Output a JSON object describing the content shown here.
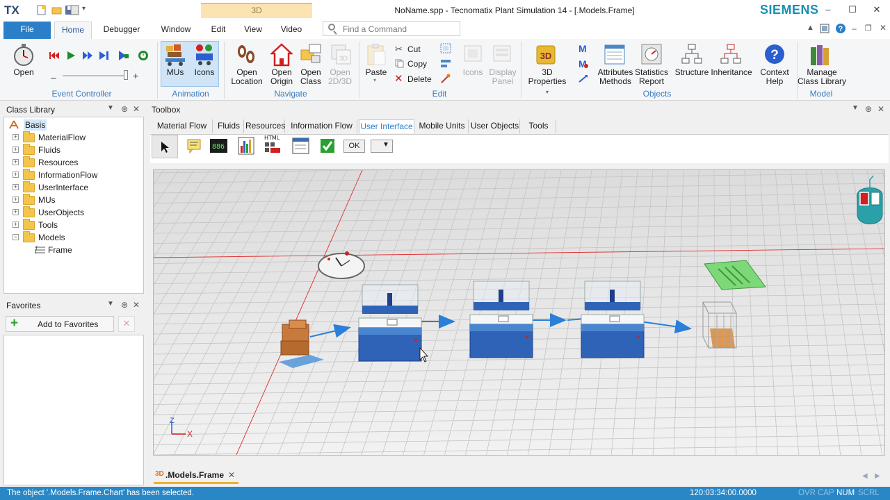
{
  "app": {
    "logo": "TX",
    "context_tab": "3D",
    "window_title": "NoName.spp - Tecnomatix Plant Simulation 14 - [.Models.Frame]",
    "brand": "SIEMENS"
  },
  "ribbon_tabs": [
    "File",
    "Home",
    "Debugger",
    "Window",
    "Edit",
    "View",
    "Video"
  ],
  "search": {
    "placeholder": "Find a Command"
  },
  "ribbon": {
    "event_controller": {
      "open_label": "Open",
      "group_label": "Event Controller"
    },
    "animation": {
      "mus_label": "MUs",
      "icons_label": "Icons",
      "group_label": "Animation"
    },
    "navigate": {
      "open_location": [
        "Open",
        "Location"
      ],
      "open_origin": [
        "Open",
        "Origin"
      ],
      "open_class": [
        "Open",
        "Class"
      ],
      "open_2d3d": [
        "Open",
        "2D/3D"
      ],
      "group_label": "Navigate"
    },
    "edit": {
      "paste": "Paste",
      "cut": "Cut",
      "copy": "Copy",
      "delete": "Delete",
      "icons": "Icons",
      "display_panel": [
        "Display",
        "Panel"
      ],
      "group_label": "Edit"
    },
    "objects": {
      "properties_3d": [
        "3D",
        "Properties"
      ],
      "attributes_methods": [
        "Attributes",
        "Methods"
      ],
      "statistics_report": [
        "Statistics",
        "Report"
      ],
      "structure": "Structure",
      "inheritance": "Inheritance",
      "context_help": [
        "Context",
        "Help"
      ],
      "group_label": "Objects"
    },
    "model": {
      "manage": [
        "Manage",
        "Class Library"
      ],
      "group_label": "Model"
    }
  },
  "class_library": {
    "title": "Class Library",
    "root": "Basis",
    "folders": [
      "MaterialFlow",
      "Fluids",
      "Resources",
      "InformationFlow",
      "UserInterface",
      "MUs",
      "UserObjects",
      "Tools",
      "Models"
    ],
    "frame_item": "Frame"
  },
  "favorites": {
    "title": "Favorites",
    "add_label": "Add to Favorites"
  },
  "toolbox": {
    "title": "Toolbox",
    "tabs": [
      "Material Flow",
      "Fluids",
      "Resources",
      "Information Flow",
      "User Interface",
      "Mobile Units",
      "User Objects",
      "Tools"
    ],
    "active_tab": "User Interface",
    "ok_label": "OK",
    "html_label": "HTML",
    "display_digits": "886"
  },
  "viewport": {
    "axis_x": "X",
    "axis_z": "Z"
  },
  "doc_tab": {
    "badge": "3D",
    "label": ".Models.Frame"
  },
  "status": {
    "message": "The object '.Models.Frame.Chart' has been selected.",
    "time": "120:03:34:00.0000",
    "indicators": [
      "OVR",
      "CAP",
      "NUM",
      "SCRL"
    ]
  },
  "colors": {
    "accent": "#2b7fc9",
    "brand": "#1a8fb0",
    "status_bar": "#2a87c6",
    "machine": "#2f63b8"
  }
}
